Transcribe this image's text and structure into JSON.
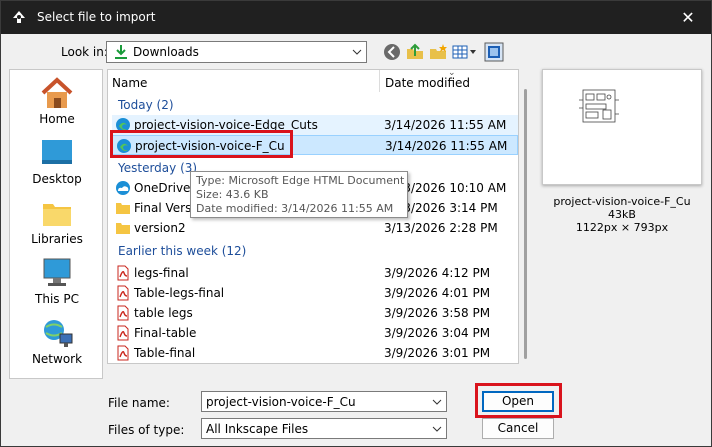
{
  "window": {
    "title": "Select file to import",
    "close_glyph": "✕"
  },
  "look_in": {
    "label": "Look in:",
    "value": "Downloads"
  },
  "places": [
    "Home",
    "Desktop",
    "Libraries",
    "This PC",
    "Network"
  ],
  "columns": {
    "name": "Name",
    "date_modified": "Date modified"
  },
  "groups": [
    {
      "label": "Today (2)",
      "files": [
        {
          "name": "project-vision-voice-Edge_Cuts",
          "date": "3/14/2026 11:55 AM",
          "icon": "edge-html-icon",
          "state": "hover"
        },
        {
          "name": "project-vision-voice-F_Cu",
          "date": "3/14/2026 11:55 AM",
          "icon": "edge-html-icon",
          "state": "selected"
        }
      ]
    },
    {
      "label": "Yesterday (3)",
      "files": [
        {
          "name": "OneDrive -",
          "date": "3/13/2026 10:10 AM",
          "icon": "onedrive-icon"
        },
        {
          "name": "Final Versio",
          "date": "3/13/2026 3:14 PM",
          "icon": "folder-icon"
        },
        {
          "name": "version2",
          "date": "3/13/2026 2:28 PM",
          "icon": "folder-icon"
        }
      ]
    },
    {
      "label": "Earlier this week (12)",
      "files": [
        {
          "name": "legs-final",
          "date": "3/9/2026 4:12 PM",
          "icon": "pdf-icon"
        },
        {
          "name": "Table-legs-final",
          "date": "3/9/2026 4:01 PM",
          "icon": "pdf-icon"
        },
        {
          "name": "table legs",
          "date": "3/9/2026 3:58 PM",
          "icon": "pdf-icon"
        },
        {
          "name": "Final-table",
          "date": "3/9/2026 3:04 PM",
          "icon": "pdf-icon"
        },
        {
          "name": "Table-final",
          "date": "3/9/2026 3:01 PM",
          "icon": "pdf-icon"
        }
      ]
    }
  ],
  "tooltip": {
    "type": "Type: Microsoft Edge HTML Document",
    "size": "Size: 43.6 KB",
    "modified": "Date modified: 3/14/2026 11:55 AM"
  },
  "preview": {
    "name": "project-vision-voice-F_Cu",
    "size": "43kB",
    "dims": "1122px × 793px"
  },
  "file_name": {
    "label": "File name:",
    "value": "project-vision-voice-F_Cu"
  },
  "file_type": {
    "label": "Files of type:",
    "value": "All Inkscape Files"
  },
  "buttons": {
    "open": "Open",
    "cancel": "Cancel"
  },
  "colors": {
    "highlight": "#d9131c",
    "selection": "#cce8ff",
    "group_header": "#1e4e9a"
  }
}
